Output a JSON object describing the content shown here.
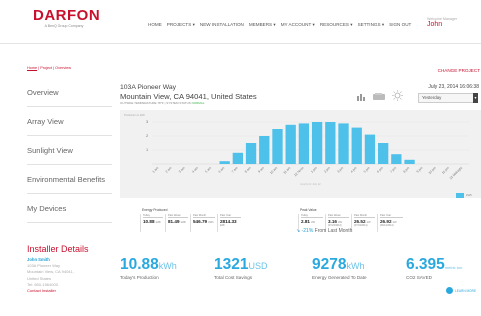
{
  "header": {
    "logo_text": "DARFON",
    "logo_sub": "A BenQ Group Company",
    "nav": [
      "HOME",
      "PROJECTS",
      "NEW INSTALLATION",
      "MEMBERS",
      "MY ACCOUNT",
      "RESOURCES",
      "SETTINGS",
      "SIGN OUT"
    ],
    "welcome": "Welcome Manager",
    "user": "John"
  },
  "sidebar": {
    "breadcrumb_home": "Home",
    "breadcrumb_rest": " | Project | Overview",
    "items": [
      "Overview",
      "Array View",
      "Sunlight View",
      "Environmental Benefits",
      "My Devices"
    ],
    "installer": {
      "title": "Installer Details",
      "name": "John Smith",
      "lines": [
        "103A Pioneer Way",
        "Mountain View, CA 94041,",
        "United States",
        "Tel: 650-1564000"
      ],
      "contact": "Contact Installer"
    }
  },
  "site": {
    "change_project": "CHANGE PROJECT",
    "address1": "103A Pioneer Way",
    "address2": "Mountain View, CA 94041, United States",
    "status_prefix": "OUTSIDE TEMPERATURE 78°F | SYSTEM STATUS ",
    "status_value": "NORMAL",
    "date": "July 23, 2014 16:06:38",
    "period": "Yesterday",
    "icons": [
      "bar-chart-icon",
      "cloud-sun-icon",
      "sun-icon"
    ]
  },
  "chart_data": {
    "type": "bar",
    "title": "",
    "ylabel": "Production in kWh",
    "xlabel": "Hourly for July 22",
    "ylim": [
      0,
      3
    ],
    "yticks": [
      1,
      2,
      3
    ],
    "categories": [
      "1 am",
      "2 am",
      "3 am",
      "4 am",
      "5 am",
      "6 am",
      "7 am",
      "8 am",
      "9 am",
      "10 am",
      "11 am",
      "12 Noon",
      "1 pm",
      "2 pm",
      "3 pm",
      "4 pm",
      "5 pm",
      "6 pm",
      "7 pm",
      "8 pm",
      "9 pm",
      "10 pm",
      "11 pm",
      "12 Midnight"
    ],
    "values": [
      0,
      0,
      0,
      0,
      0,
      0.2,
      0.8,
      1.5,
      2.0,
      2.5,
      2.8,
      2.9,
      3.0,
      3.0,
      2.9,
      2.6,
      2.1,
      1.5,
      0.7,
      0.3,
      0,
      0,
      0,
      0
    ],
    "legend": "kWh",
    "bar_color": "#4dc1ea"
  },
  "metrics": {
    "energy_title": "Energy Produced",
    "energy": [
      {
        "cap": "Today",
        "val": "10.88",
        "unit": "kWh"
      },
      {
        "cap": "Past Week",
        "val": "81.49",
        "unit": "kWh"
      },
      {
        "cap": "Past Month",
        "val": "546.79",
        "unit": "kWh"
      },
      {
        "cap": "Past Year",
        "val": "2814.33",
        "unit": "kWh"
      }
    ],
    "peak_title": "Peak Value",
    "peak": [
      {
        "cap": "Today",
        "val": "2.81",
        "unit": "kW",
        "sub": ""
      },
      {
        "cap": "Past Week",
        "val": "3.16",
        "unit": "kW",
        "sub": "(07/23/2014)"
      },
      {
        "cap": "Past Month",
        "val": "26.52",
        "unit": "kW",
        "sub": "(07/04/2014)"
      },
      {
        "cap": "Past Year",
        "val": "26.92",
        "unit": "kW",
        "sub": "(06/12/2014)"
      }
    ],
    "trend_value": "-21%",
    "trend_label": " From Last Month"
  },
  "stats": [
    {
      "num": "10.88",
      "unit": "kWh",
      "label": "Today's Production"
    },
    {
      "num": "1321",
      "unit": "USD",
      "label": "Total Cost Savings"
    },
    {
      "num": "9278",
      "unit": "kWh",
      "label": "Energy Generated To Date"
    },
    {
      "num": "6.395",
      "unit": "metric ton",
      "label": "CO2 SAVED"
    }
  ],
  "learn_more": "LEARN MORE"
}
